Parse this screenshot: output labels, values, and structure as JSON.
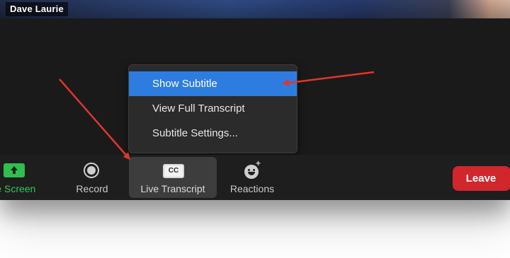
{
  "video": {
    "participant_name": "Dave Laurie"
  },
  "caption_menu": {
    "items": [
      {
        "label": "Show Subtitle",
        "highlighted": true
      },
      {
        "label": "View Full Transcript",
        "highlighted": false
      },
      {
        "label": "Subtitle Settings...",
        "highlighted": false
      }
    ]
  },
  "toolbar": {
    "share_screen_label": "re Screen",
    "record_label": "Record",
    "live_transcript_label": "Live Transcript",
    "cc_icon_text": "CC",
    "reactions_label": "Reactions",
    "leave_label": "Leave"
  },
  "icons": {
    "share": "share-screen-icon",
    "record": "record-icon",
    "cc": "closed-caption-icon",
    "reactions": "emoji-plus-icon"
  },
  "colors": {
    "menu_highlight": "#2d7de0",
    "share_green": "#34c759",
    "leave_red": "#d1262c",
    "annotation_arrow": "#e0362c",
    "toolbar_bg": "#1e1e1e",
    "active_tool_bg": "#3d3d3d"
  }
}
